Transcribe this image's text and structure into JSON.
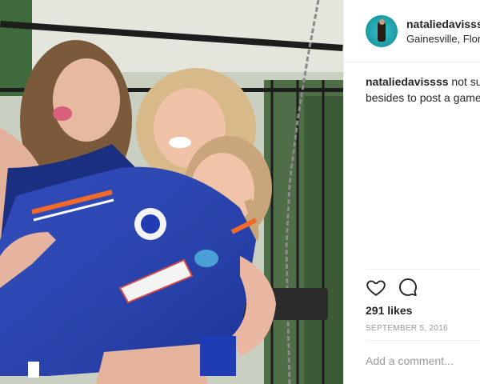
{
  "post": {
    "photo_alt": "",
    "header": {
      "username": "nataliedavissss",
      "location": "Gainesville, Florida"
    },
    "caption": {
      "username": "nataliedavissss",
      "text": " not sure what else to do besides to post a game day pic"
    },
    "likes_text": "291 likes",
    "date_text": "SEPTEMBER 5, 2016",
    "comment_placeholder": "Add a comment...",
    "icons": {
      "like": "heart-icon",
      "comment": "speech-bubble-icon"
    }
  }
}
